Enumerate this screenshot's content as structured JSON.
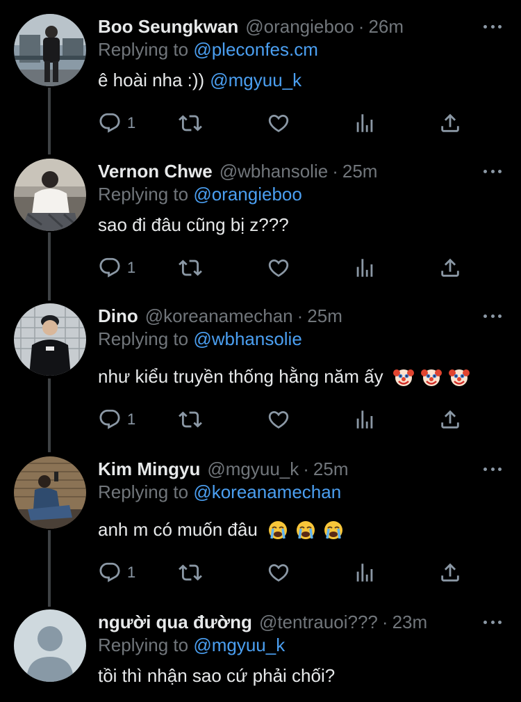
{
  "replies": [
    {
      "name": "Boo Seungkwan",
      "handle": "@orangieboo",
      "time": "26m",
      "replying_label": "Replying to",
      "replying_to": "@pleconfes.cm",
      "text": "ê hoài nha :))",
      "text_mention": "@mgyuu_k",
      "reply_count": "1",
      "avatar": "photo-man-street"
    },
    {
      "name": "Vernon Chwe",
      "handle": "@wbhansolie",
      "time": "25m",
      "replying_label": "Replying to",
      "replying_to": "@orangieboo",
      "text": "sao đi đâu cũng bị z???",
      "reply_count": "1",
      "avatar": "photo-man-sitting"
    },
    {
      "name": "Dino",
      "handle": "@koreanamechan",
      "time": "25m",
      "replying_label": "Replying to",
      "replying_to": "@wbhansolie",
      "text": "như kiểu truyền thống hằng năm ấy",
      "emojis": [
        "clown-face-emoji",
        "clown-face-emoji",
        "clown-face-emoji"
      ],
      "reply_count": "1",
      "avatar": "photo-man-fence"
    },
    {
      "name": "Kim Mingyu",
      "handle": "@mgyuu_k",
      "time": "25m",
      "replying_label": "Replying to",
      "replying_to": "@koreanamechan",
      "text": "anh m có muốn đâu",
      "emojis": [
        "loudly-crying-emoji",
        "loudly-crying-emoji",
        "loudly-crying-emoji"
      ],
      "reply_count": "1",
      "avatar": "photo-man-wall"
    },
    {
      "name": "người qua đường",
      "handle": "@tentrauoi???",
      "time": "23m",
      "replying_label": "Replying to",
      "replying_to": "@mgyuu_k",
      "text": "tồi thì nhận sao cứ phải chối?",
      "avatar": "default-profile"
    }
  ],
  "colors": {
    "background": "#000000",
    "text": "#e7e9ea",
    "secondary": "#71767b",
    "link": "#4b9ff1",
    "thread_line": "#3e4144"
  },
  "icons": [
    "reply-icon",
    "retweet-icon",
    "like-icon",
    "view-stats-icon",
    "share-icon",
    "more-options-icon"
  ]
}
